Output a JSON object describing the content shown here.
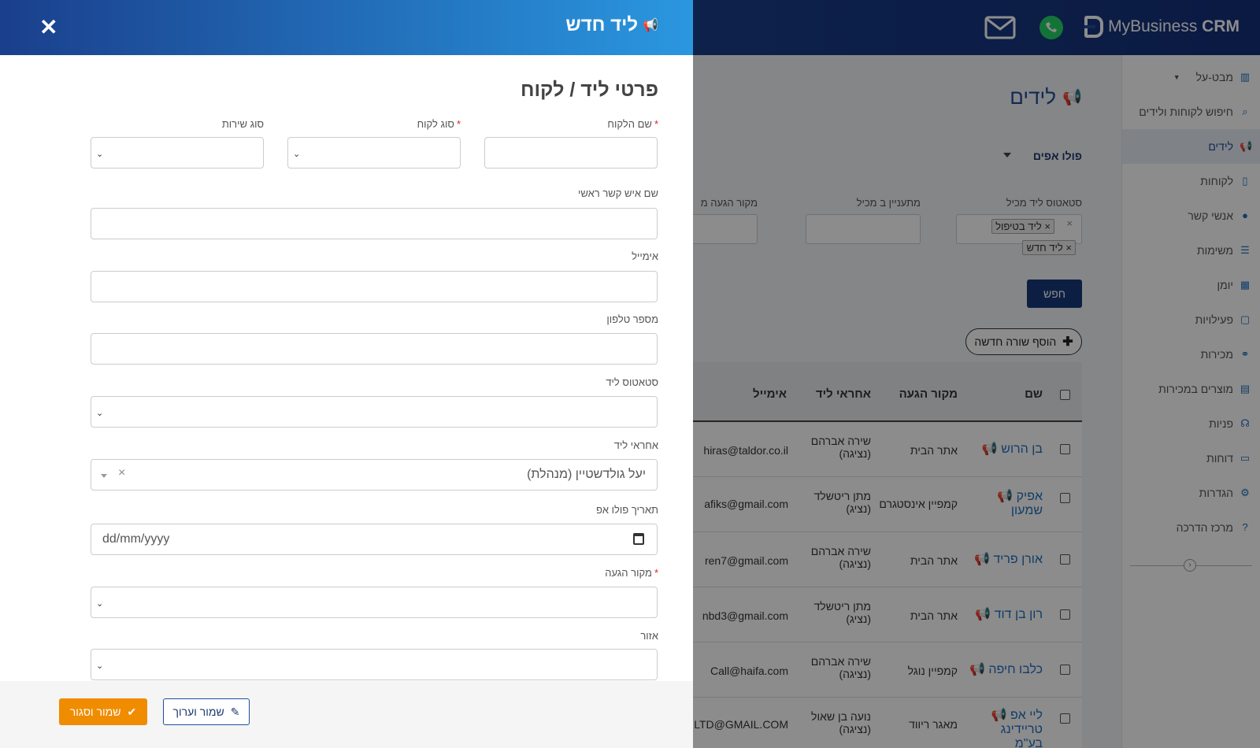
{
  "app": {
    "brand_light": "MyBusiness",
    "brand_bold": "CRM"
  },
  "sidebar": {
    "items": [
      {
        "label": "מבט-על",
        "icon": "bar-chart-icon"
      },
      {
        "label": "חיפוש לקוחות ולידים",
        "icon": "search-icon"
      },
      {
        "label": "לידים",
        "icon": "megaphone-icon",
        "active": true
      },
      {
        "label": "לקוחות",
        "icon": "building-icon"
      },
      {
        "label": "אנשי קשר",
        "icon": "user-icon"
      },
      {
        "label": "משימות",
        "icon": "list-icon"
      },
      {
        "label": "יומן",
        "icon": "calendar-icon"
      },
      {
        "label": "פעילויות",
        "icon": "calendar-icon"
      },
      {
        "label": "מכירות",
        "icon": "handshake-icon"
      },
      {
        "label": "מוצרים במכירות",
        "icon": "barcode-icon"
      },
      {
        "label": "פניות",
        "icon": "headset-icon"
      },
      {
        "label": "דוחות",
        "icon": "file-icon"
      },
      {
        "label": "הגדרות",
        "icon": "gear-icon"
      },
      {
        "label": "מרכז הדרכה",
        "icon": "question-icon"
      }
    ]
  },
  "main": {
    "title": "לידים",
    "followup_label": "פולו אפים",
    "filters": {
      "status_label": "סטאטוס ליד מכיל",
      "interest_label": "מתעניין ב מכיל",
      "source_label": "מקור הגעה מ",
      "tags": [
        "ליד בטיפול",
        "ליד חדש"
      ]
    },
    "search_button": "חפש",
    "add_row_button": "הוסף שורה חדשה",
    "table": {
      "headers": {
        "name": "שם",
        "source": "מקור הגעה",
        "owner": "אחראי ליד",
        "email": "אימייל"
      },
      "rows": [
        {
          "name": "בן הרוש",
          "source": "אתר הבית",
          "owner": "שירה אברהם (נציגה)",
          "email": "hiras@taldor.co.il"
        },
        {
          "name": "אפיק שמעון",
          "source": "קמפיין אינסטגרם",
          "owner": "מתן ריטשלד (נציג)",
          "email": "afiks@gmail.com"
        },
        {
          "name": "אורן פריד",
          "source": "אתר הבית",
          "owner": "שירה אברהם (נציגה)",
          "email": "ren7@gmail.com"
        },
        {
          "name": "רון בן דוד",
          "source": "אתר הבית",
          "owner": "מתן ריטשלד (נציג)",
          "email": "nbd3@gmail.com"
        },
        {
          "name": "כלבו חיפה",
          "source": "קמפיין נוגל",
          "owner": "שירה אברהם (נציגה)",
          "email": "Call@haifa.com"
        },
        {
          "name": "ליי אפ טריידינג בע\"מ",
          "source": "מאגר ריווד",
          "owner": "נועה בן שאול (נציגה)",
          "email": "LTD@GMAIL.COM"
        }
      ]
    }
  },
  "panel": {
    "title": "ליד חדש",
    "section_title": "פרטי ליד / לקוח",
    "fields": {
      "customer_name": "שם הלקוח",
      "customer_type": "סוג לקוח",
      "service_type": "סוג שירות",
      "contact_name": "שם איש קשר ראשי",
      "email": "אימייל",
      "phone": "מספר טלפון",
      "lead_status": "סטאטוס ליד",
      "lead_owner": "אחראי ליד",
      "lead_owner_value": "יעל גולדשטיין (מנהלת)",
      "followup_date": "תאריך פולו אפ",
      "followup_date_placeholder": "dd/mm/yyyy",
      "source": "מקור הגעה",
      "region": "אזור"
    },
    "buttons": {
      "save_close": "שמור וסגור",
      "save_edit": "שמור וערוך"
    }
  }
}
